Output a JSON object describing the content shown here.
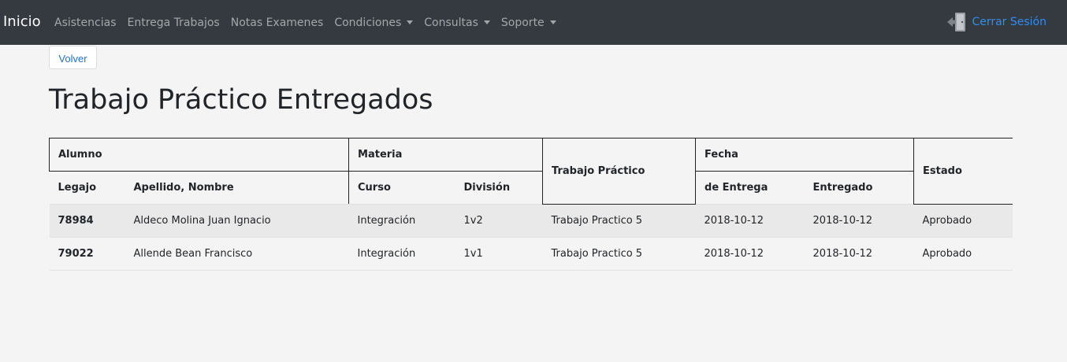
{
  "navbar": {
    "brand": "Inicio",
    "items": [
      {
        "label": "Asistencias",
        "dropdown": false
      },
      {
        "label": "Entrega Trabajos",
        "dropdown": false
      },
      {
        "label": "Notas Examenes",
        "dropdown": false
      },
      {
        "label": "Condiciones",
        "dropdown": true
      },
      {
        "label": "Consultas",
        "dropdown": true
      },
      {
        "label": "Soporte",
        "dropdown": true
      }
    ],
    "logout_label": "Cerrar Sesión",
    "logout_icon": "door-exit-icon"
  },
  "back_button": "Volver",
  "page_title": "Trabajo Práctico Entregados",
  "table": {
    "groups": {
      "alumno": "Alumno",
      "materia": "Materia",
      "trabajo": "Trabajo Práctico",
      "fecha": "Fecha",
      "estado": "Estado"
    },
    "columns": {
      "legajo": "Legajo",
      "nombre": "Apellido, Nombre",
      "curso": "Curso",
      "division": "División",
      "entrega": "de Entrega",
      "entregado": "Entregado"
    },
    "rows": [
      {
        "legajo": "78984",
        "nombre": "Aldeco Molina Juan Ignacio",
        "curso": "Integración",
        "division": "1v2",
        "trabajo": "Trabajo Practico 5",
        "entrega": "2018-10-12",
        "entregado": "2018-10-12",
        "estado": "Aprobado"
      },
      {
        "legajo": "79022",
        "nombre": "Allende Bean Francisco",
        "curso": "Integración",
        "division": "1v1",
        "trabajo": "Trabajo Practico 5",
        "entrega": "2018-10-12",
        "entregado": "2018-10-12",
        "estado": "Aprobado"
      }
    ]
  },
  "colors": {
    "navbar_bg": "#343a40",
    "link_blue": "#2f8df5",
    "page_bg": "#f4f4f4"
  }
}
